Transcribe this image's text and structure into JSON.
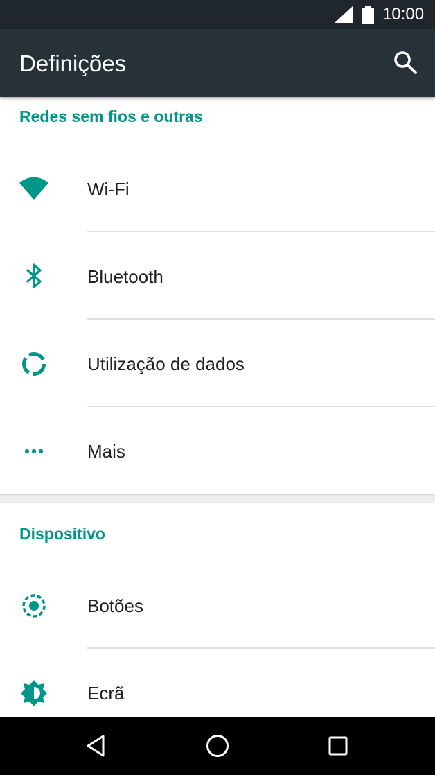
{
  "status_bar": {
    "time": "10:00"
  },
  "app_bar": {
    "title": "Definições"
  },
  "sections": {
    "wireless": {
      "header": "Redes sem fios e outras",
      "items": [
        {
          "label": "Wi-Fi",
          "icon": "wifi-icon"
        },
        {
          "label": "Bluetooth",
          "icon": "bluetooth-icon"
        },
        {
          "label": "Utilização de dados",
          "icon": "data-usage-icon"
        },
        {
          "label": "Mais",
          "icon": "more-dots-icon"
        }
      ]
    },
    "device": {
      "header": "Dispositivo",
      "items": [
        {
          "label": "Botões",
          "icon": "buttons-icon"
        },
        {
          "label": "Ecrã",
          "icon": "brightness-icon"
        }
      ]
    }
  },
  "colors": {
    "accent": "#009688",
    "app_bar": "#263238",
    "status_bar": "#1f262c",
    "background": "#eeeeee"
  }
}
